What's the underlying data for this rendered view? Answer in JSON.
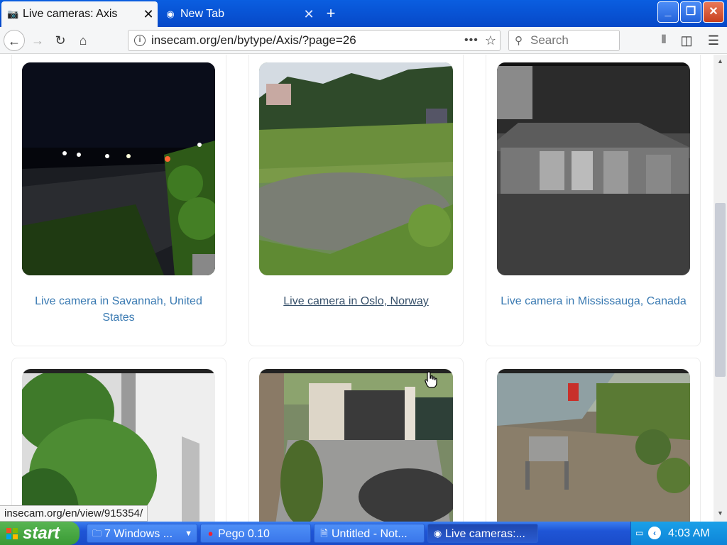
{
  "browser": {
    "tabs": [
      {
        "title": "Live cameras: Axis",
        "active": true
      },
      {
        "title": "New Tab",
        "active": false
      }
    ],
    "new_tab_symbol": "+",
    "window_controls": {
      "minimize": "_",
      "maximize": "❐",
      "close": "✕"
    },
    "url": "insecam.org/en/bytype/Axis/?page=26",
    "page_actions_symbol": "•••",
    "search_placeholder": "Search"
  },
  "cameras": [
    {
      "caption": "Live camera in Savannah, United States"
    },
    {
      "caption": "Live camera in Oslo, Norway",
      "hovered": true
    },
    {
      "caption": "Live camera in Mississauga, Canada"
    }
  ],
  "status_url": "insecam.org/en/view/915354/",
  "taskbar": {
    "start_label": "start",
    "tasks": [
      {
        "label": "7 Windows ...",
        "icon": "folder-icon"
      },
      {
        "label": "Pego 0.10",
        "icon": "app-icon"
      },
      {
        "label": "Untitled - Not...",
        "icon": "notepad-icon"
      },
      {
        "label": "Live cameras:...",
        "icon": "browser-icon",
        "active": true
      }
    ],
    "clock": "4:03 AM"
  }
}
